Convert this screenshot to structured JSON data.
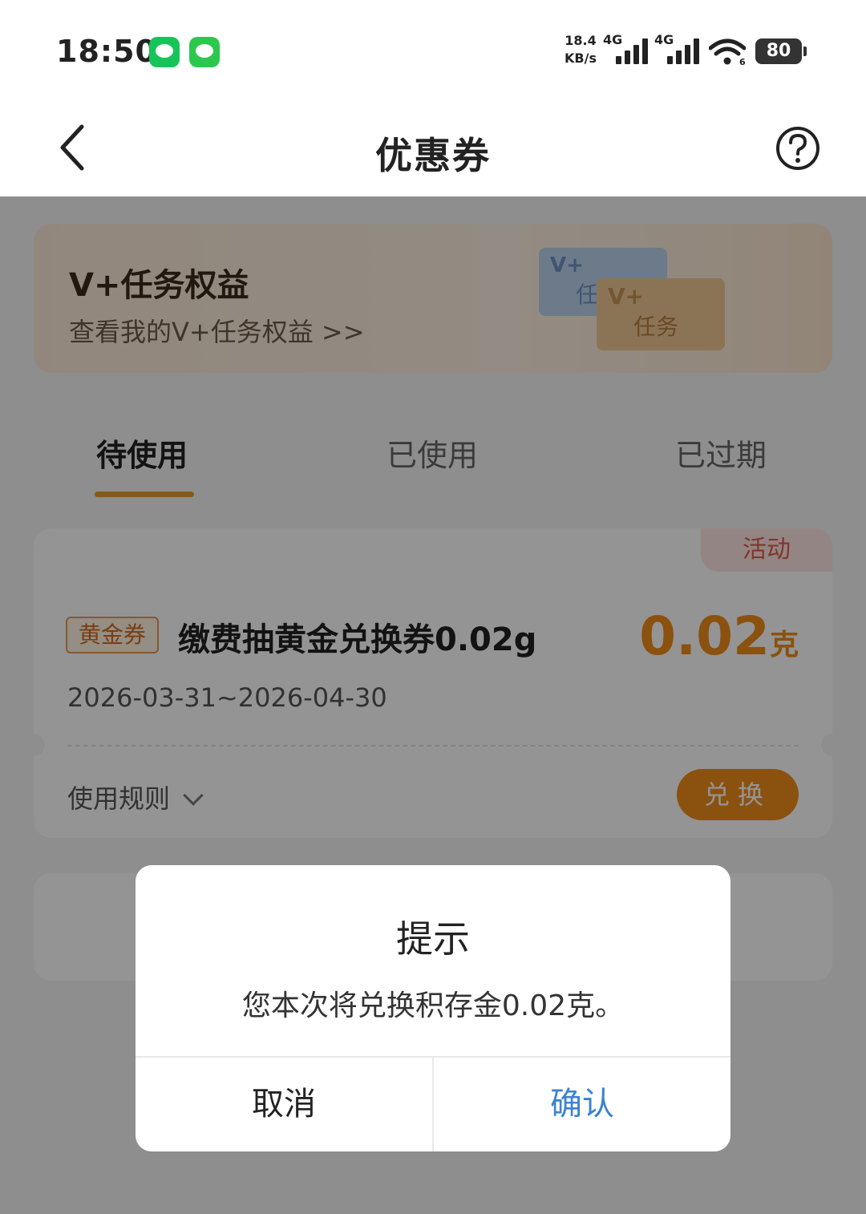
{
  "status_bar": {
    "time": "18:50",
    "net_speed_value": "18.4",
    "net_speed_unit": "KB/s",
    "sim1_type": "4G",
    "sim2_type": "4G",
    "wifi_label": "6",
    "battery": "80",
    "icons": [
      "wechat-icon",
      "messages-icon",
      "signal-icon",
      "wifi-icon",
      "battery-icon"
    ]
  },
  "navbar": {
    "title": "优惠券",
    "back_icon": "chevron-left-icon",
    "help_icon": "question-circle-icon"
  },
  "banner": {
    "title": "V+任务权益",
    "subtitle": "查看我的V+任务权益 >>",
    "card_back_text": "V+",
    "card_back_sub": "任",
    "card_front_text": "V+",
    "card_front_sub": "任务"
  },
  "tabs": [
    {
      "label": "待使用",
      "active": true
    },
    {
      "label": "已使用",
      "active": false
    },
    {
      "label": "已过期",
      "active": false
    }
  ],
  "coupon": {
    "badge": "活动",
    "type_tag": "黄金券",
    "title": "缴费抽黄金兑换券0.02g",
    "amount": "0.02",
    "amount_unit": "克",
    "validity": "2026-03-31~2026-04-30",
    "rules_label": "使用规则",
    "redeem_label": "兑换",
    "accent_color": "#f08c1a"
  },
  "dialog": {
    "title": "提示",
    "message": "您本次将兑换积存金0.02克。",
    "cancel_label": "取消",
    "confirm_label": "确认",
    "confirm_color": "#3b82d0"
  }
}
